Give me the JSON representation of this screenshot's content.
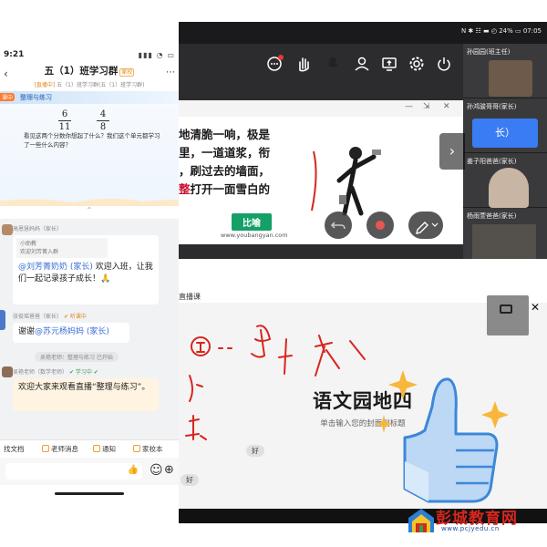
{
  "phone": {
    "status": {
      "time": "9:21",
      "icons": "▮▮▮ ◔ ▭"
    },
    "group": {
      "title": "五（1）班学习群",
      "tag": "家校",
      "sub_live": "[直播中]",
      "sub_text": "五（1）班学习群(五（1）班学习群)"
    },
    "back": "‹",
    "more": "⋯",
    "lesson": {
      "badge": "课中",
      "name": "整理与练习",
      "fractions": [
        {
          "num": "6",
          "den": "11"
        },
        {
          "num": "4",
          "den": "8"
        }
      ],
      "question": "看见这两个分数你想起了什么？我们这个单元都学习了一些什么内容？"
    },
    "fold_icon": "⌃",
    "messages": [
      {
        "sender": "高恩慧妈妈（家长）",
        "quote_line1": "小助教",
        "quote_line2": "欢迎刘芳菁入群",
        "mention": "@刘芳菁奶奶 (家长)",
        "text": " 欢迎入班，让我们一起记录孩子成长！🙏"
      },
      {
        "sender": "张俊瑶爸爸（家长）",
        "sender_status": "✔ 听课中",
        "mention": "@苏元杨妈妈 (家长)",
        "text": "谢谢",
        "mention_after": true
      },
      {
        "system": "吴艳老师：整理与练习 已开始"
      },
      {
        "sender": "吴艳老师（数学老师）",
        "sender_status": "✔ 学习中 ✔",
        "text": "欢迎大家来观看直播“整理与练习”。"
      }
    ],
    "toolbar": {
      "items": [
        "找文档",
        "老师消息",
        "通知",
        "家校本"
      ]
    },
    "input_icons": {
      "like": "👍",
      "emoji": "☺",
      "add": "⊕"
    }
  },
  "win1": {
    "status_text": "N ✱ ☷ ▬ ◴ 24% ▭ 07:05",
    "toolbar_icons": [
      "chat-icon",
      "raise-hand-icon",
      "mic-icon",
      "user-icon",
      "share-screen-icon",
      "settings-icon",
      "power-icon"
    ],
    "participants": [
      {
        "name": "孙园园(班主任)"
      },
      {
        "name": "孙鸿骏哥哥(家长)"
      },
      {
        "name": "姜子阳爸爸(家长)"
      },
      {
        "name": "杨雨萱爸爸(家长)"
      }
    ],
    "tile2_text": "长）",
    "slide": {
      "lines": [
        {
          "text": "地清脆一响，极是",
          "hl": false
        },
        {
          "text": "里，一道道浆，衔",
          "hl": false
        },
        {
          "text": "，刷过去的墙面，",
          "hl": false
        },
        {
          "pre": "",
          "hl_text": "整",
          "text": "打开一面雪白的",
          "hl": true
        }
      ],
      "tag": "比喻",
      "url": "www.youbangyan.com"
    },
    "window_controls": [
      "—",
      "⇲",
      "✕"
    ]
  },
  "win2": {
    "header": "直播课",
    "title": "语文园地四",
    "subtitle": "单击输入您的封面副标题",
    "danmaku": [
      "好",
      "好"
    ],
    "close": "✕"
  },
  "watermark": {
    "title": "彭城教育网",
    "url": "www.pcjyedu.cn"
  },
  "colors": {
    "accent": "#f29c34",
    "red": "#d7261e",
    "green": "#14a067",
    "link": "#3b6fd6"
  }
}
